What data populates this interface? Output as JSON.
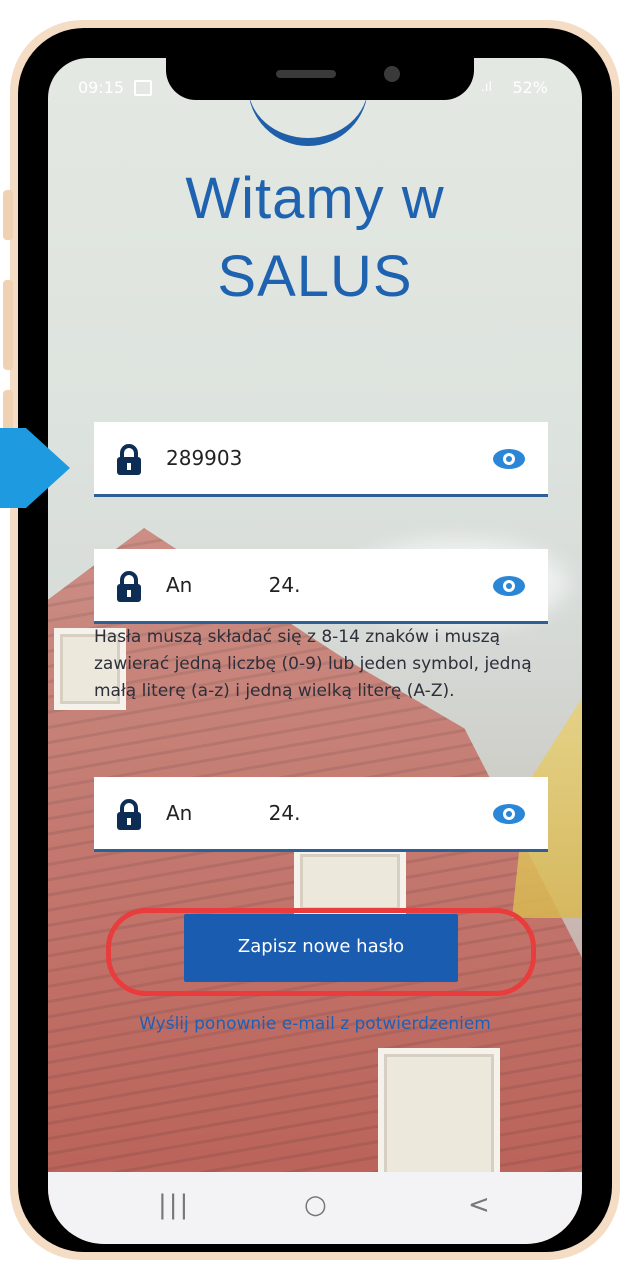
{
  "status_bar": {
    "time": "09:15",
    "battery": "52%"
  },
  "title": {
    "line1": "Witamy w",
    "line2": "SALUS"
  },
  "fields": [
    {
      "value": "289903",
      "icon": "lock-icon",
      "action_icon": "eye-icon"
    },
    {
      "value": "An            24.",
      "icon": "lock-icon",
      "action_icon": "eye-icon"
    },
    {
      "value": "An            24.",
      "icon": "lock-icon",
      "action_icon": "eye-icon"
    }
  ],
  "helper_text": "Hasła muszą składać się z 8-14 znaków i muszą zawierać jedną liczbę (0-9) lub jeden symbol, jedną małą literę (a-z) i jedną wielką literę (A-Z).",
  "save_button": "Zapisz nowe hasło",
  "resend_link": "Wyślij ponownie e-mail z potwierdzeniem",
  "navbar": {
    "recents": "|||",
    "home": "○",
    "back": "<"
  },
  "colors": {
    "accent": "#1a5cb0",
    "highlight": "#e93c3c",
    "pointer": "#1e9be0"
  }
}
